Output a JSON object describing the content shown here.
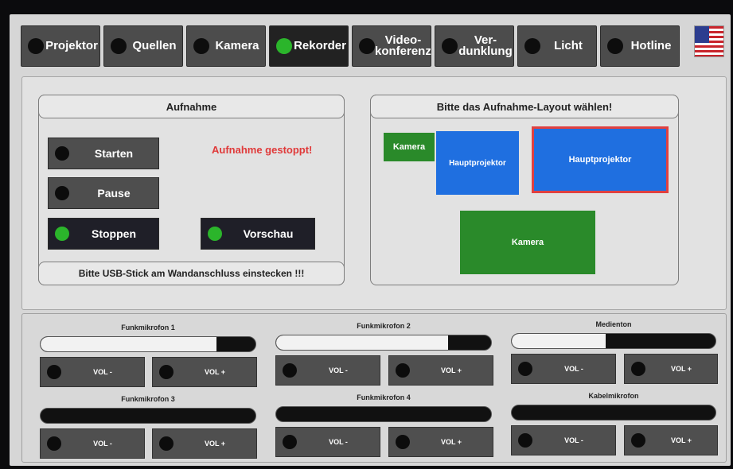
{
  "nav": {
    "items": [
      {
        "label": "Projektor",
        "active": false
      },
      {
        "label": "Quellen",
        "active": false
      },
      {
        "label": "Kamera",
        "active": false
      },
      {
        "label": "Rekorder",
        "active": true
      },
      {
        "label": "Video-\nkonferenz",
        "active": false
      },
      {
        "label": "Ver-\ndunklung",
        "active": false
      },
      {
        "label": "Licht",
        "active": false
      },
      {
        "label": "Hotline",
        "active": false
      }
    ],
    "language_icon": "us-flag-icon"
  },
  "recording": {
    "title": "Aufnahme",
    "status": "Aufnahme gestoppt!",
    "buttons": {
      "start": "Starten",
      "pause": "Pause",
      "stop": "Stoppen",
      "preview": "Vorschau"
    },
    "hint": "Bitte USB-Stick am Wandanschluss einstecken !!!"
  },
  "layout": {
    "title": "Bitte das Aufnahme-Layout wählen!",
    "tiles": {
      "pip_camera": "Kamera",
      "pip_projector": "Hauptprojektor",
      "full_projector": "Hauptprojektor",
      "full_camera": "Kamera"
    }
  },
  "audio": {
    "channels": [
      {
        "name": "Funkmikrofon 1",
        "level": 0.82,
        "vol_minus": "VOL -",
        "vol_plus": "VOL +"
      },
      {
        "name": "Funkmikrofon 2",
        "level": 0.8,
        "vol_minus": "VOL -",
        "vol_plus": "VOL +"
      },
      {
        "name": "Medienton",
        "level": 0.46,
        "vol_minus": "VOL -",
        "vol_plus": "VOL +"
      },
      {
        "name": "Funkmikrofon 3",
        "level": 0.0,
        "vol_minus": "VOL -",
        "vol_plus": "VOL +"
      },
      {
        "name": "Funkmikrofon 4",
        "level": 0.0,
        "vol_minus": "VOL -",
        "vol_plus": "VOL +"
      },
      {
        "name": "Kabelmikrofon",
        "level": 0.0,
        "vol_minus": "VOL -",
        "vol_plus": "VOL +"
      }
    ]
  },
  "colors": {
    "active_led": "#2bb52b",
    "status_error": "#e03a3a",
    "tile_blue": "#1f6fe0",
    "tile_green": "#2a8a2a",
    "selection": "#e04040"
  }
}
